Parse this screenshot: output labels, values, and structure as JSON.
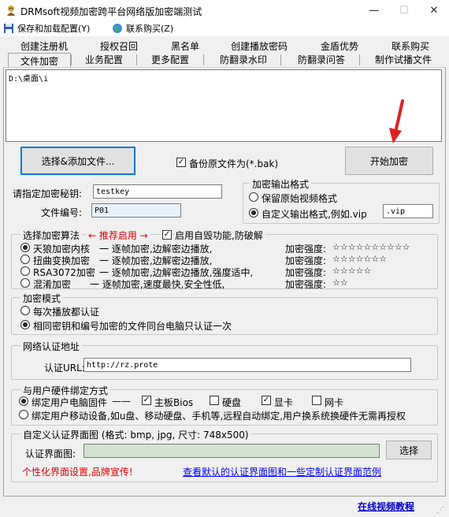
{
  "window": {
    "title": "DRMsoft视频加密跨平台网络版加密端测试"
  },
  "menu": {
    "save_load": "保存和加载配置(Y)",
    "contact_buy": "联系购买(Z)"
  },
  "tabs": {
    "row1": [
      "创建注册机",
      "授权召回",
      "黑名单",
      "创建播放密码",
      "金盾优势",
      "联系购买"
    ],
    "row2": [
      "文件加密",
      "业务配置",
      "更多配置",
      "防翻录水印",
      "防翻录问答",
      "制作试播文件"
    ]
  },
  "file_area": {
    "path": "D:\\桌面\\i"
  },
  "buttons": {
    "select_files": "选择&添加文件...",
    "start_encrypt": "开始加密",
    "browse": "选择"
  },
  "backup": {
    "label": "备份原文件为(*.bak)",
    "checked": true
  },
  "key": {
    "label": "请指定加密秘钥:",
    "value": "testkey"
  },
  "file_no": {
    "label": "文件编号:",
    "value": "P01"
  },
  "output_format": {
    "legend": "加密输出格式",
    "keep_original": "保留原始视频格式",
    "custom": "自定义输出格式,例如.vip",
    "custom_value": ".vip",
    "selected": "custom"
  },
  "algorithm": {
    "legend": "选择加密算法",
    "recommend": "← 推荐启用 →",
    "self_destruct": "启用自毁功能,防破解",
    "self_destruct_checked": true,
    "options": [
      {
        "name": "天狼加密内核",
        "desc": "一 逐帧加密,边解密边播放,",
        "strength_label": "加密强度:",
        "stars": "☆☆☆☆☆☆☆☆☆☆"
      },
      {
        "name": "扭曲变换加密",
        "desc": "一 逐帧加密,边解密边播放,",
        "strength_label": "加密强度:",
        "stars": "☆☆☆☆☆☆☆"
      },
      {
        "name": "RSA3072加密",
        "desc": "一 逐帧加密,边解密边播放,强度适中,",
        "strength_label": "加密强度:",
        "stars": "☆☆☆☆☆"
      },
      {
        "name": "混淆加密",
        "desc": "一 逐帧加密,速度最快,安全性低,",
        "strength_label": "加密强度:",
        "stars": "☆☆"
      }
    ],
    "selected_index": 0
  },
  "mode": {
    "legend": "加密模式",
    "opt1": "每次播放都认证",
    "opt2": "相同密钥和编号加密的文件同台电脑只认证一次",
    "selected": 2
  },
  "network": {
    "legend": "网络认证地址",
    "label": "认证URL:",
    "value": "http://rz.prote"
  },
  "hardware": {
    "legend": "与用户硬件绑定方式",
    "bind_pc": "绑定用户电脑固件",
    "dash": "——",
    "mainboard": "主板Bios",
    "disk": "硬盘",
    "gpu": "显卡",
    "nic": "网卡",
    "mainboard_checked": true,
    "disk_checked": false,
    "gpu_checked": true,
    "nic_checked": false,
    "bind_mobile": "绑定用户移动设备,如u盘、移动硬盘、手机等,远程自动绑定,用户换系统换硬件无需再授权",
    "selected": 1
  },
  "custom_ui": {
    "legend": "自定义认证界面图 (格式: bmp, jpg, 尺寸: 748x500)",
    "label": "认证界面图:",
    "value": "",
    "slogan": "个性化界面设置,品牌宣传!",
    "sample_link": "查看默认的认证界面图和一些定制认证界面范例"
  },
  "footer": {
    "tutorial_link": "在线视频教程"
  }
}
